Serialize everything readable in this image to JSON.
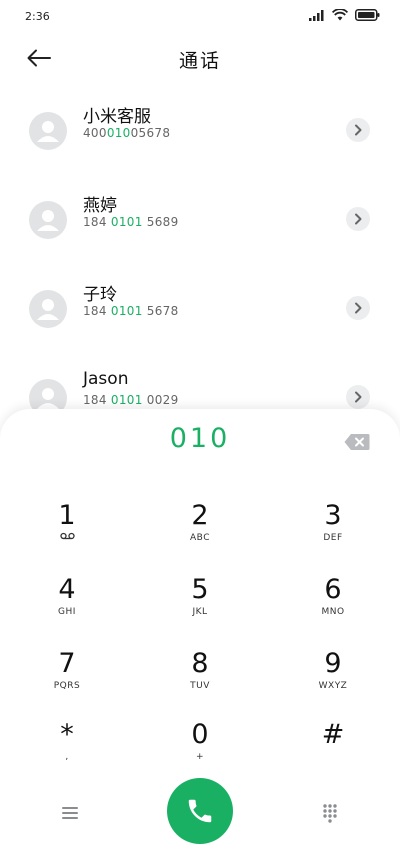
{
  "status_bar": {
    "time": "2:36"
  },
  "header": {
    "title": "通话"
  },
  "contacts": [
    {
      "name": "小米客服",
      "num_pre": "400",
      "num_hl": "010",
      "num_post": "05678"
    },
    {
      "name": "燕婷",
      "num_pre": "184 ",
      "num_hl": "0101",
      "num_post": " 5689"
    },
    {
      "name": "子玲",
      "num_pre": "184 ",
      "num_hl": "0101",
      "num_post": " 5678"
    },
    {
      "name": "Jason",
      "num_pre": "184 ",
      "num_hl": "0101",
      "num_post": " 0029"
    }
  ],
  "dialer": {
    "input": "010",
    "keys": [
      {
        "digit": "1",
        "letters": ""
      },
      {
        "digit": "2",
        "letters": "ABC"
      },
      {
        "digit": "3",
        "letters": "DEF"
      },
      {
        "digit": "4",
        "letters": "GHI"
      },
      {
        "digit": "5",
        "letters": "JKL"
      },
      {
        "digit": "6",
        "letters": "MNO"
      },
      {
        "digit": "7",
        "letters": "PQRS"
      },
      {
        "digit": "8",
        "letters": "TUV"
      },
      {
        "digit": "9",
        "letters": "WXYZ"
      },
      {
        "digit": "*",
        "letters": ","
      },
      {
        "digit": "0",
        "letters": "+"
      },
      {
        "digit": "#",
        "letters": ""
      }
    ]
  },
  "colors": {
    "accent": "#1ab064",
    "avatar_bg": "#e2e3e5",
    "chevron_bg": "#ecedef"
  },
  "icons": {
    "status": [
      "signal-icon",
      "wifi-icon",
      "battery-icon"
    ],
    "header": "back-arrow-icon",
    "contact_avatar": "person-icon",
    "contact_action": "chevron-right-icon",
    "dialer_delete": "backspace-icon",
    "key_1_sub": "voicemail-icon",
    "bottom": [
      "menu-icon",
      "phone-icon",
      "dialpad-icon"
    ]
  }
}
